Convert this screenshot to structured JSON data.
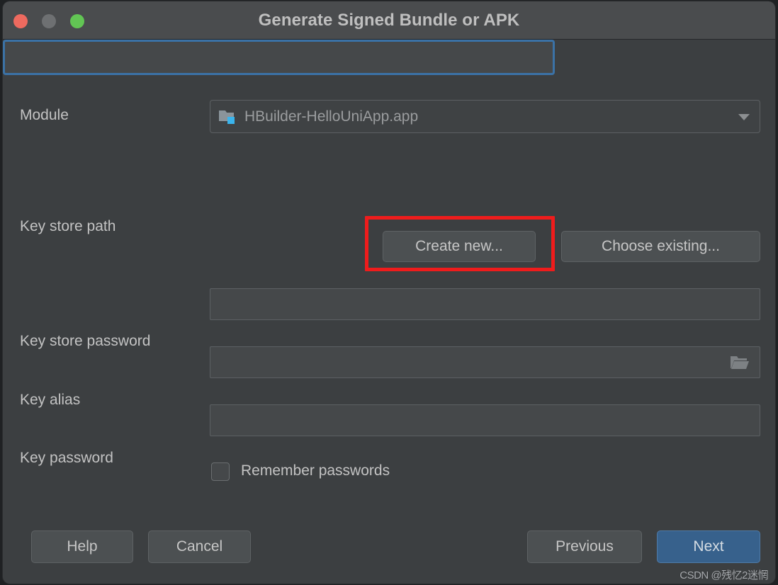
{
  "window": {
    "title": "Generate Signed Bundle or APK",
    "controls": {
      "close": "close-window",
      "minimize": "minimize-window",
      "maximize": "maximize-window"
    }
  },
  "form": {
    "module": {
      "label": "Module",
      "value": "HBuilder-HelloUniApp.app",
      "icon": "module-folder-icon"
    },
    "key_store_path": {
      "label": "Key store path",
      "value": "",
      "focused": true
    },
    "key_store_buttons": {
      "create_new": "Create new...",
      "choose_existing": "Choose existing..."
    },
    "key_store_password": {
      "label": "Key store password",
      "value": ""
    },
    "key_alias": {
      "label": "Key alias",
      "value": "",
      "browse_icon": "folder-open-icon"
    },
    "key_password": {
      "label": "Key password",
      "value": ""
    },
    "remember_passwords": {
      "label": "Remember passwords",
      "checked": false
    }
  },
  "footer": {
    "help": "Help",
    "cancel": "Cancel",
    "previous": "Previous",
    "next": "Next"
  },
  "annotation": {
    "target": "Create new...",
    "color": "#ef1c1c"
  },
  "watermark": {
    "text": "CSDN @残忆2迷惘"
  }
}
